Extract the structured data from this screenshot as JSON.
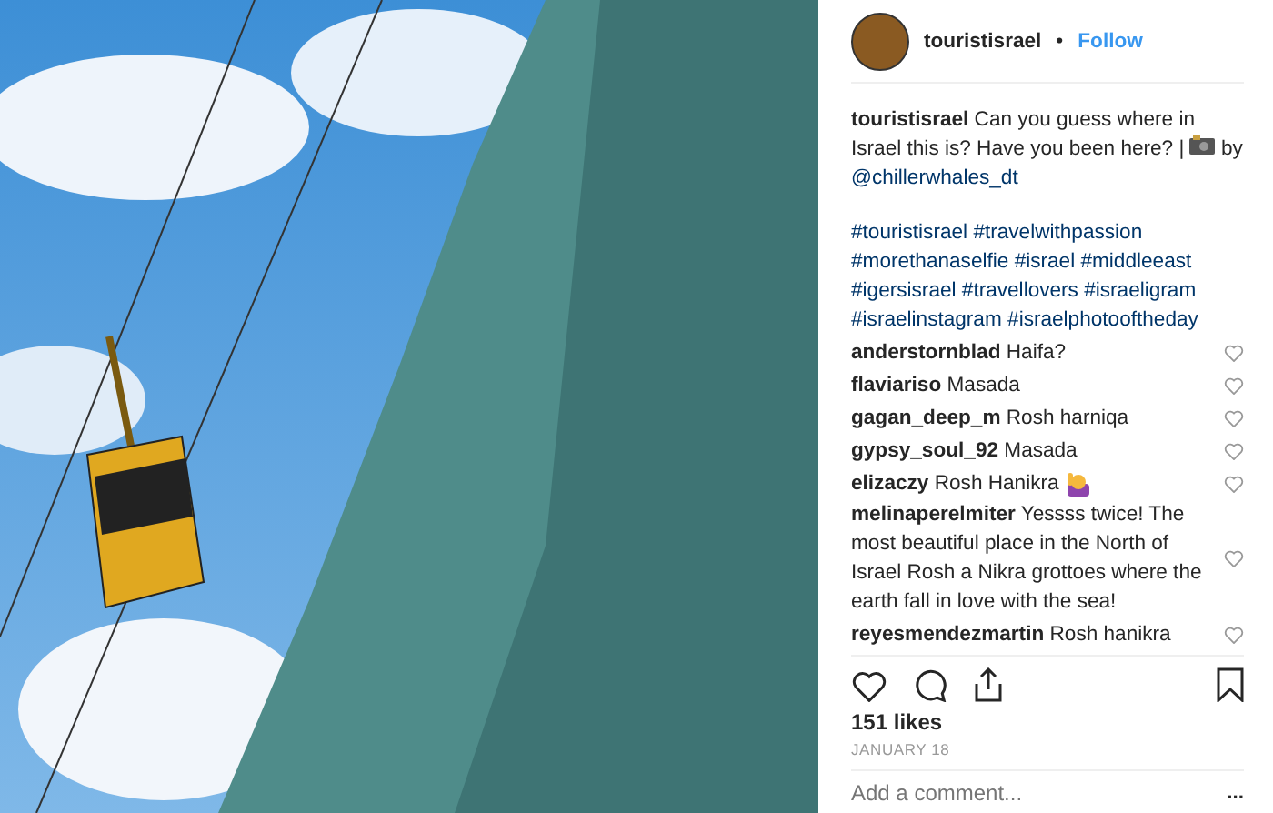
{
  "post": {
    "header": {
      "username": "touristisrael",
      "separator": "•",
      "follow": "Follow"
    },
    "caption": {
      "text": "**touristisrael** Can you guess where in Israel this is? Have you been here? |",
      "after_icon": "by",
      "mention": "@chillerwhales_dt"
    },
    "hashtags": [
      "#touristisrael",
      "#travelwithpassion",
      "#morethanaselfie",
      "#israel",
      "#middleeast",
      "#igersisrael",
      "#travellovers",
      "#israeligram",
      "#israelinstagram",
      "#israelphotooftheday"
    ],
    "comments": [
      {
        "text": "**anderstornblad** Haifa?",
        "emoji": false
      },
      {
        "text": "**flaviariso** Masada",
        "emoji": false
      },
      {
        "text": "**gagan_deep_m** Rosh harniqa",
        "emoji": false
      },
      {
        "text": "**gypsy_soul_92** Masada",
        "emoji": false
      },
      {
        "text": "**elizaczy** Rosh Hanikra",
        "emoji": true
      },
      {
        "text": "**melinaperelmiter** Yessss twice! The most beautiful place in the North of Israel Rosh a Nikra grottoes where the earth fall in love with the sea!",
        "emoji": false
      },
      {
        "text": "**reyesmendezmartin** Rosh hanikra",
        "emoji": false
      }
    ],
    "likes": "151 likes",
    "date": "JANUARY 18",
    "add_comment": {
      "placeholder": "Add a comment..."
    },
    "more": "..."
  }
}
